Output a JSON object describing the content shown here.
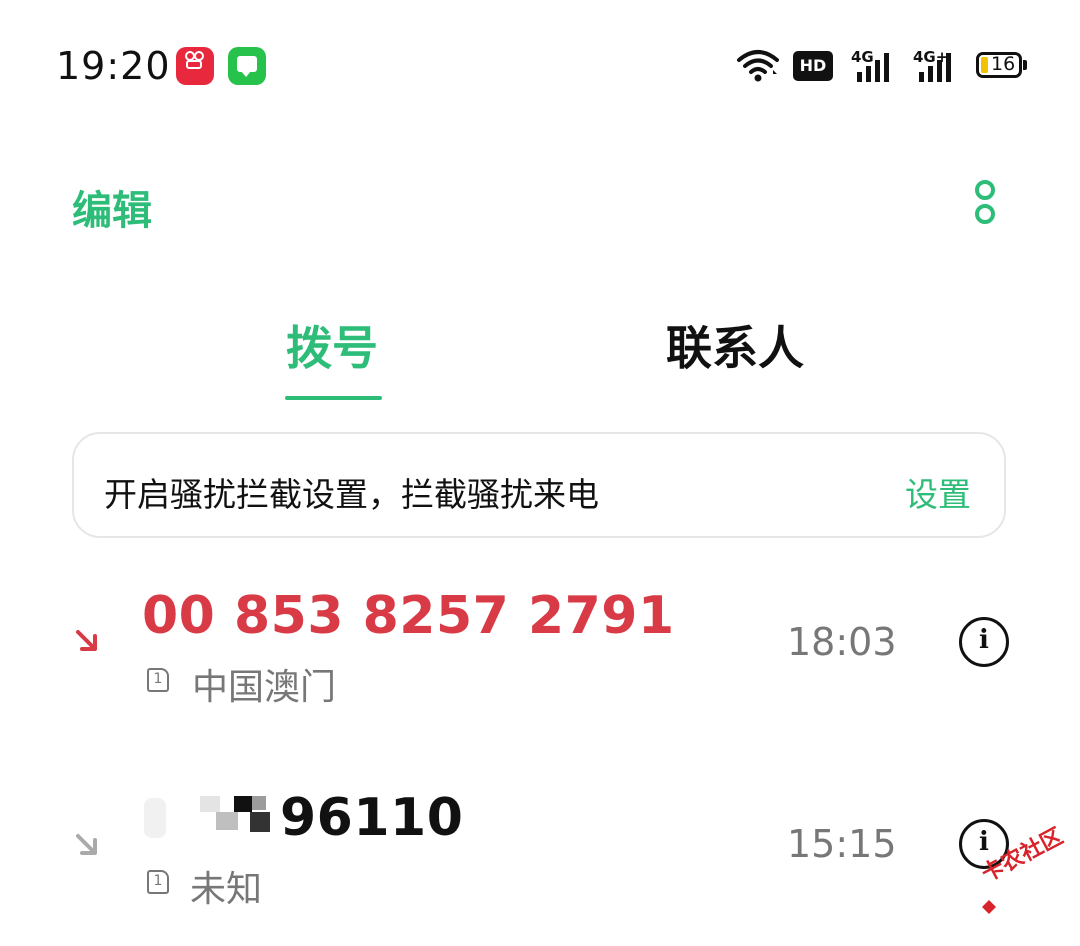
{
  "status_bar": {
    "time": "19:20",
    "apps": [
      "kuaishou-app-icon",
      "messages-app-icon"
    ],
    "hd_label": "HD",
    "signal1_label": "4G",
    "signal2_label": "4G+",
    "battery_level": "16",
    "colors": {
      "battery_fill": "#f2c200"
    }
  },
  "toolbar": {
    "edit_label": "编辑",
    "more_icon": "more-vertical-icon"
  },
  "tabs": [
    {
      "label": "拨号",
      "active": true
    },
    {
      "label": "联系人",
      "active": false
    }
  ],
  "banner": {
    "text": "开启骚扰拦截设置，拦截骚扰来电",
    "action_label": "设置"
  },
  "calls": [
    {
      "number": "00 853 8257 2791",
      "type": "missed",
      "sim": "1",
      "location": "中国澳门",
      "time": "18:03"
    },
    {
      "number": "96110",
      "type": "incoming",
      "sim": "1",
      "location": "未知",
      "time": "15:15"
    }
  ],
  "watermark": "卡农社区",
  "colors": {
    "accent": "#2ebd78",
    "missed": "#d83a46",
    "secondary_text": "#777777"
  }
}
